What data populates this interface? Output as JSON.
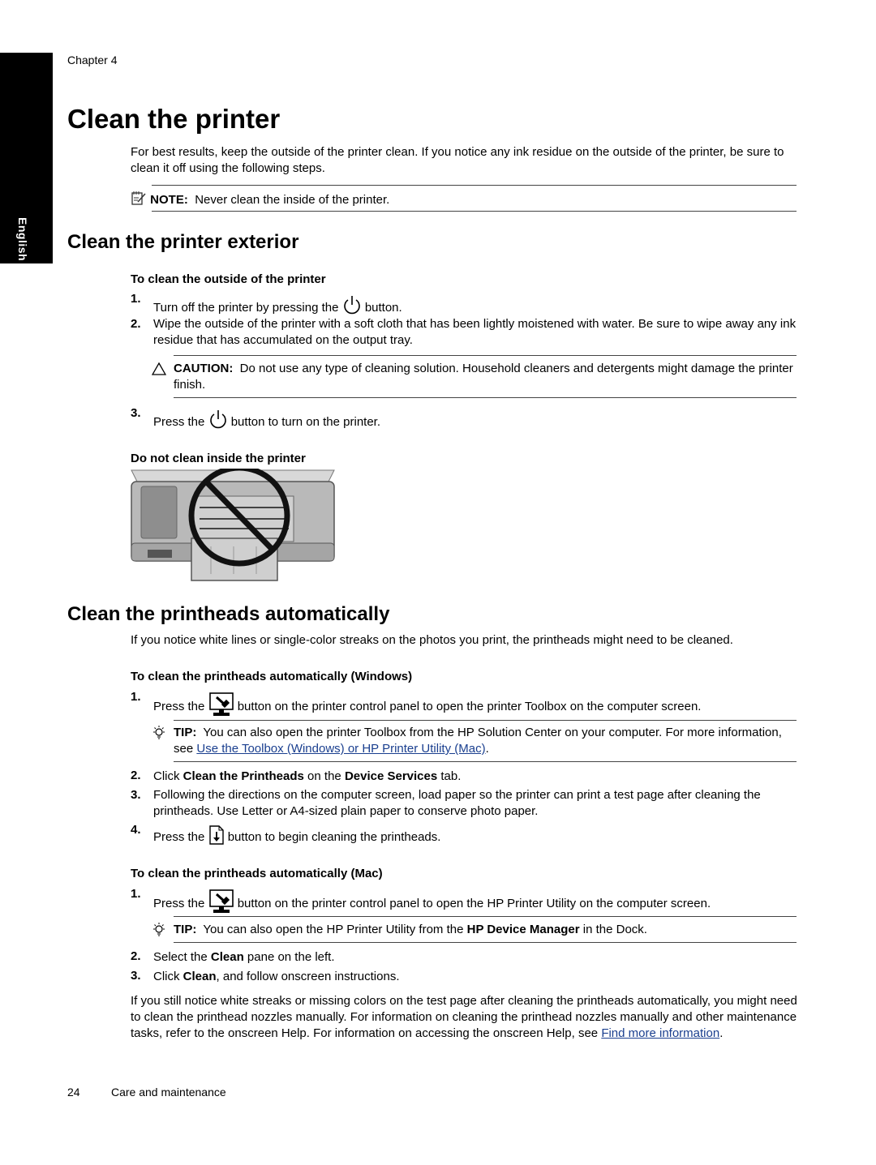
{
  "side_tab": {
    "label": "English"
  },
  "header": {
    "chapter": "Chapter 4"
  },
  "title": "Clean the printer",
  "intro": "For best results, keep the outside of the printer clean. If you notice any ink residue on the outside of the printer, be sure to clean it off using the following steps.",
  "note": {
    "icon": "note-icon",
    "label": "NOTE:",
    "text": "Never clean the inside of the printer."
  },
  "exterior": {
    "heading": "Clean the printer exterior",
    "subheading": "To clean the outside of the printer",
    "steps": [
      {
        "num": "1.",
        "before": "Turn off the printer by pressing the",
        "icon": "power-icon",
        "after": "button."
      },
      {
        "num": "2.",
        "text": "Wipe the outside of the printer with a soft cloth that has been lightly moistened with water. Be sure to wipe away any ink residue that has accumulated on the output tray."
      },
      {
        "num": "3.",
        "before": "Press the",
        "icon": "power-icon",
        "after": "button to turn on the printer."
      }
    ],
    "caution": {
      "icon": "caution-triangle-icon",
      "label": "CAUTION:",
      "text": "Do not use any type of cleaning solution. Household cleaners and detergents might damage the printer finish."
    },
    "figure_caption": "Do not clean inside the printer"
  },
  "printheads": {
    "heading": "Clean the printheads automatically",
    "intro": "If you notice white lines or single-color streaks on the photos you print, the printheads might need to be cleaned.",
    "windows": {
      "subheading": "To clean the printheads automatically (Windows)",
      "step1": {
        "num": "1.",
        "before": "Press the",
        "icon": "toolbox-icon",
        "after": "button on the printer control panel to open the printer Toolbox on the computer screen."
      },
      "tip": {
        "icon": "lightbulb-icon",
        "label": "TIP:",
        "text": "You can also open the printer Toolbox from the HP Solution Center on your computer. For more information, see",
        "link": "Use the Toolbox (Windows) or HP Printer Utility (Mac)",
        "end": "."
      },
      "step2": {
        "num": "2.",
        "a": "Click",
        "b": "Clean the Printheads",
        "c": "on the",
        "d": "Device Services",
        "e": "tab."
      },
      "step3": {
        "num": "3.",
        "text": "Following the directions on the computer screen, load paper so the printer can print a test page after cleaning the printheads. Use Letter or A4-sized plain paper to conserve photo paper."
      },
      "step4": {
        "num": "4.",
        "before": "Press the",
        "icon": "print-download-icon",
        "after": "button to begin cleaning the printheads."
      }
    },
    "mac": {
      "subheading": "To clean the printheads automatically (Mac)",
      "step1": {
        "num": "1.",
        "before": "Press the",
        "icon": "toolbox-icon",
        "after": "button on the printer control panel to open the HP Printer Utility on the computer screen."
      },
      "tip": {
        "icon": "lightbulb-icon",
        "label": "TIP:",
        "a": "You can also open the HP Printer Utility from the",
        "b": "HP Device Manager",
        "c": "in the Dock."
      },
      "step2": {
        "num": "2.",
        "a": "Select the",
        "b": "Clean",
        "c": "pane on the left."
      },
      "step3": {
        "num": "3.",
        "a": "Click",
        "b": "Clean",
        "c": ", and follow onscreen instructions."
      }
    },
    "closing": {
      "text": "If you still notice white streaks or missing colors on the test page after cleaning the printheads automatically, you might need to clean the printhead nozzles manually. For information on cleaning the printhead nozzles manually and other maintenance tasks, refer to the onscreen Help. For information on accessing the onscreen Help, see",
      "link": "Find more information",
      "end": "."
    }
  },
  "footer": {
    "page": "24",
    "section": "Care and maintenance"
  },
  "colors": {
    "link": "#1a3f8f"
  }
}
